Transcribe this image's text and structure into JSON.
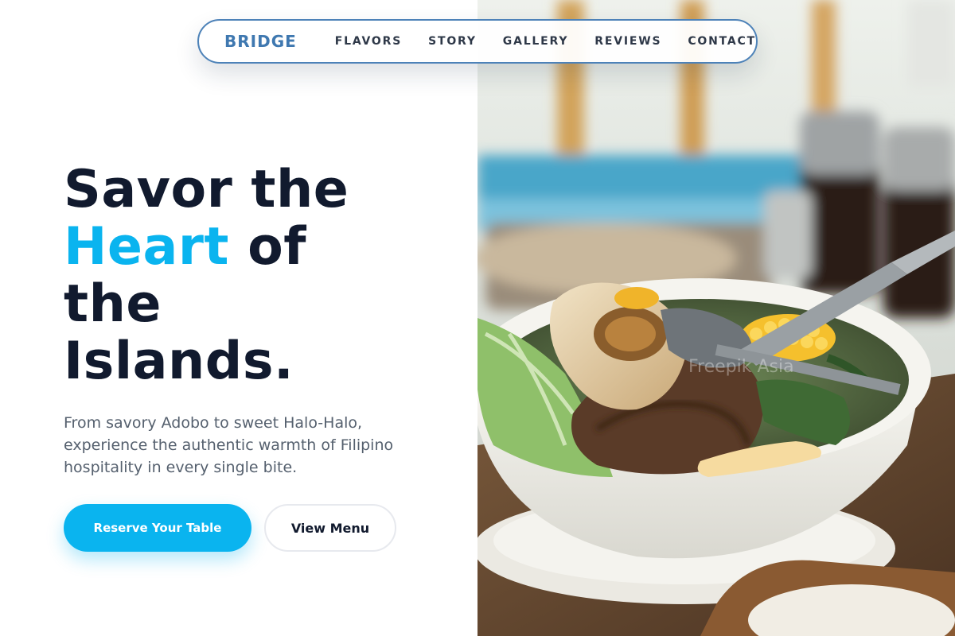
{
  "nav": {
    "brand": "BRIDGE",
    "links": [
      "FLAVORS",
      "STORY",
      "GALLERY",
      "REVIEWS",
      "CONTACT"
    ]
  },
  "hero": {
    "headline_part1": "Savor the",
    "headline_accent": "Heart",
    "headline_part2": "of",
    "headline_part3": "the",
    "headline_part4": "Islands.",
    "subtitle": "From savory Adobo to sweet Halo-Halo, experience the authentic warmth of Filipino hospitality in every single bite.",
    "primary_cta": "Reserve Your Table",
    "secondary_cta": "View Menu"
  },
  "colors": {
    "accent": "#0ab4ef",
    "headline": "#111a2e",
    "brand": "#3f78b0",
    "nav_border": "#4d82b8"
  },
  "image": {
    "subject": "bulalo soup bowl with beef bone, corn and cabbage",
    "watermark": "Freepik Asia"
  }
}
